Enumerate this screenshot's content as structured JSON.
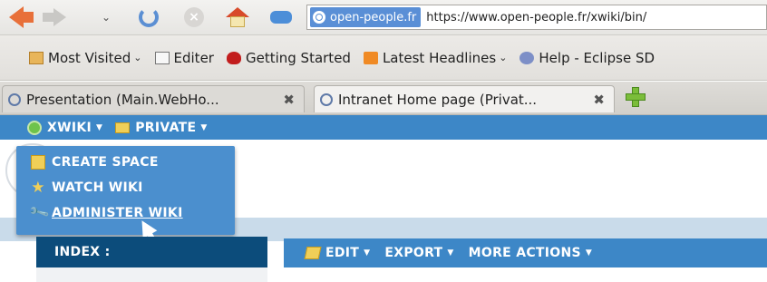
{
  "browser": {
    "nav": {
      "back_icon": "back-arrow-icon",
      "forward_icon": "forward-arrow-icon",
      "history_icon": "chevron-down-icon",
      "reload_icon": "reload-icon",
      "stop_icon": "stop-icon",
      "home_icon": "home-icon",
      "bookmark_icon": "bookmarks-icon"
    },
    "urlbar": {
      "site_identity": "open-people.fr",
      "url": "https://www.open-people.fr/xwiki/bin/"
    },
    "bookmarks": [
      {
        "label": "Most Visited",
        "icon": "folder-icon",
        "dropdown": true
      },
      {
        "label": "Editer",
        "icon": "page-icon",
        "dropdown": false
      },
      {
        "label": "Getting Started",
        "icon": "firefox-icon",
        "dropdown": false
      },
      {
        "label": "Latest Headlines",
        "icon": "rss-icon",
        "dropdown": true
      },
      {
        "label": "Help - Eclipse SD",
        "icon": "eclipse-icon",
        "dropdown": false
      }
    ],
    "tabs": [
      {
        "label": "Presentation (Main.WebHo...",
        "close": "✖",
        "active": false
      },
      {
        "label": "Intranet Home page (Privat...",
        "close": "✖",
        "active": true
      }
    ]
  },
  "xwiki": {
    "menu": [
      {
        "label": "XWIKI",
        "caret": "▼"
      },
      {
        "label": "PRIVATE",
        "caret": "▼"
      }
    ],
    "dropdown": [
      {
        "label": "CREATE SPACE",
        "icon": "create-space-icon",
        "symbol": ""
      },
      {
        "label": "WATCH WIKI",
        "icon": "star-icon",
        "symbol": "★"
      },
      {
        "label": "ADMINISTER WIKI",
        "icon": "wrench-icon",
        "symbol": "🔧"
      }
    ],
    "index": {
      "label": "INDEX :"
    },
    "actions": [
      {
        "label": "EDIT",
        "caret": "▼"
      },
      {
        "label": "EXPORT",
        "caret": "▼"
      },
      {
        "label": "MORE ACTIONS",
        "caret": "▼"
      }
    ]
  },
  "colors": {
    "xwiki_blue": "#3d87c7",
    "dropdown_blue": "#4b8fce",
    "index_navy": "#0c4c7b",
    "url_identity": "#5a8fd6"
  }
}
